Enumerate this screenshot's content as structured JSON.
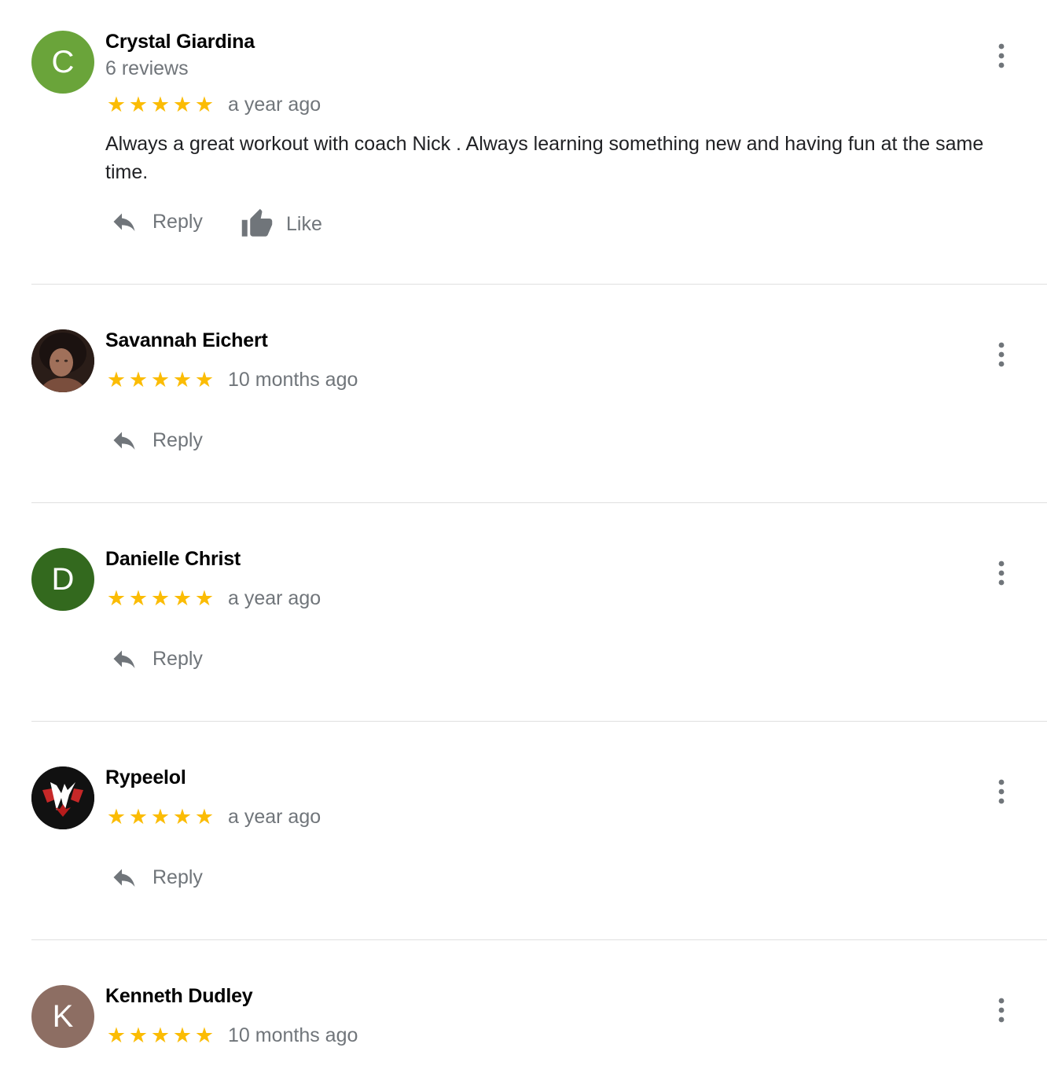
{
  "reviews": [
    {
      "name": "Crystal Giardina",
      "subline": "6 reviews",
      "avatar_letter": "C",
      "avatar_color": "#6aa43a",
      "stars": [
        "★",
        "★",
        "★",
        "★",
        "★"
      ],
      "time": "a year ago",
      "text": "Always a great workout with coach Nick . Always learning something new and having fun at the same time.",
      "reply_label": "Reply",
      "like_label": "Like"
    },
    {
      "name": "Savannah Eichert",
      "avatar_color": "#3b2a24",
      "stars": [
        "★",
        "★",
        "★",
        "★",
        "★"
      ],
      "time": "10 months ago",
      "reply_label": "Reply"
    },
    {
      "name": "Danielle Christ",
      "avatar_letter": "D",
      "avatar_color": "#33691e",
      "stars": [
        "★",
        "★",
        "★",
        "★",
        "★"
      ],
      "time": "a year ago",
      "reply_label": "Reply"
    },
    {
      "name": "Rypeelol",
      "avatar_color": "#111111",
      "stars": [
        "★",
        "★",
        "★",
        "★",
        "★"
      ],
      "time": "a year ago",
      "reply_label": "Reply"
    },
    {
      "name": "Kenneth Dudley",
      "avatar_letter": "K",
      "avatar_color": "#8d6e63",
      "stars": [
        "★",
        "★",
        "★",
        "★",
        "★"
      ],
      "time": "10 months ago"
    }
  ],
  "colors": {
    "star": "#fbbc04",
    "secondary_text": "#70757a",
    "icon": "#70757a",
    "divider": "#e0e0e0"
  },
  "icons": {
    "reply": "reply-icon",
    "like": "thumb-up-icon",
    "menu": "more-vertical-icon"
  }
}
